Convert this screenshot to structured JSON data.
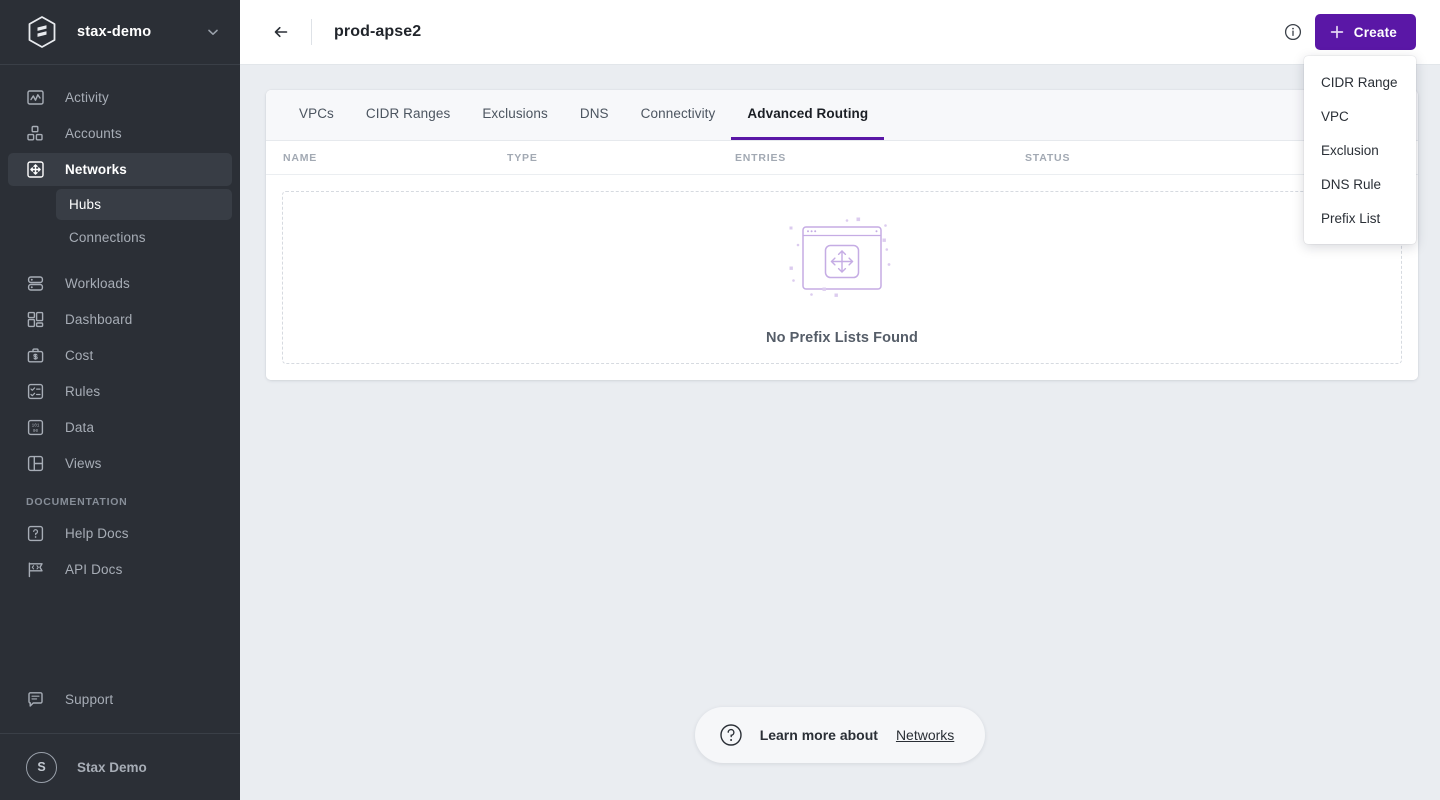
{
  "sidebar": {
    "org": {
      "name": "stax-demo",
      "logo_icon": "stax-hexagon-logo",
      "chevron_icon": "chevron-down-icon"
    },
    "items": [
      {
        "label": "Activity",
        "icon": "activity-chart-icon",
        "active": false
      },
      {
        "label": "Accounts",
        "icon": "accounts-grid-icon",
        "active": false
      },
      {
        "label": "Networks",
        "icon": "networks-move-icon",
        "active": true
      },
      {
        "label": "Workloads",
        "icon": "workloads-server-icon",
        "active": false
      },
      {
        "label": "Dashboard",
        "icon": "dashboard-layout-icon",
        "active": false
      },
      {
        "label": "Cost",
        "icon": "cost-briefcase-icon",
        "active": false
      },
      {
        "label": "Rules",
        "icon": "rules-checklist-icon",
        "active": false
      },
      {
        "label": "Data",
        "icon": "data-binary-icon",
        "active": false
      },
      {
        "label": "Views",
        "icon": "views-panel-icon",
        "active": false
      }
    ],
    "sub_items": [
      {
        "label": "Hubs",
        "active": true
      },
      {
        "label": "Connections",
        "active": false
      }
    ],
    "documentation_label": "DOCUMENTATION",
    "doc_items": [
      {
        "label": "Help Docs",
        "icon": "help-question-icon"
      },
      {
        "label": "API Docs",
        "icon": "api-code-flag-icon"
      }
    ],
    "support": {
      "label": "Support",
      "icon": "support-chat-icon"
    },
    "user": {
      "initial": "S",
      "name": "Stax Demo"
    }
  },
  "topbar": {
    "back_icon": "arrow-left-icon",
    "title": "prod-apse2",
    "info_icon": "info-circle-icon",
    "create_label": "Create",
    "create_icon": "plus-icon",
    "accent_color": "#5A17A6"
  },
  "dropdown": {
    "items": [
      {
        "label": "CIDR Range"
      },
      {
        "label": "VPC"
      },
      {
        "label": "Exclusion"
      },
      {
        "label": "DNS Rule"
      },
      {
        "label": "Prefix List"
      }
    ]
  },
  "tabs": [
    {
      "label": "VPCs",
      "active": false
    },
    {
      "label": "CIDR Ranges",
      "active": false
    },
    {
      "label": "Exclusions",
      "active": false
    },
    {
      "label": "DNS",
      "active": false
    },
    {
      "label": "Connectivity",
      "active": false
    },
    {
      "label": "Advanced Routing",
      "active": true
    }
  ],
  "table": {
    "columns": [
      "NAME",
      "TYPE",
      "ENTRIES",
      "STATUS"
    ],
    "rows": []
  },
  "empty_state": {
    "message": "No Prefix Lists Found",
    "illustration_icon": "empty-window-move-illustration",
    "illustration_color": "#C5ACE4"
  },
  "toast": {
    "icon": "question-circle-icon",
    "text": "Learn more about",
    "link": "Networks"
  }
}
